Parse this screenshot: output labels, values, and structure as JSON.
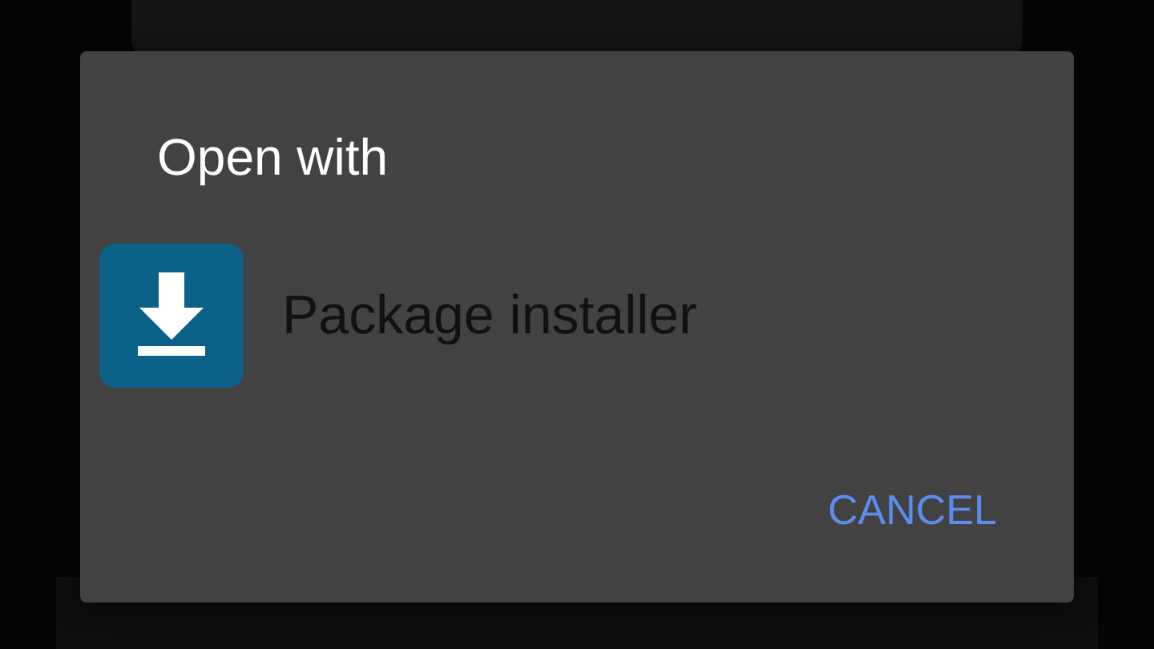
{
  "dialog": {
    "title": "Open with",
    "apps": [
      {
        "label": "Package installer"
      }
    ],
    "buttons": [
      "CANCEL"
    ]
  }
}
